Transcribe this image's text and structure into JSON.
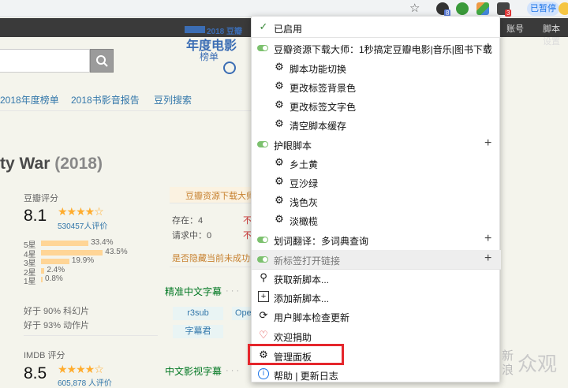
{
  "browser": {
    "paused_label": "已暂停",
    "ext_badge_1": "8",
    "ext_badge_2": "3"
  },
  "site_header": {
    "items": [
      "账号",
      "脚本设置"
    ]
  },
  "banner": {
    "line1": "2018 豆瓣",
    "line2": "年度电影",
    "line3": "榜单"
  },
  "nav": {
    "items": [
      "2018年度榜单",
      "2018书影音报告",
      "豆列搜索"
    ]
  },
  "movie": {
    "title": "ty War",
    "year": "(2018)"
  },
  "rating": {
    "label": "豆瓣评分",
    "score": "8.1",
    "stars": "★★★★☆",
    "count": "530457人评价",
    "breakdown": [
      {
        "star": "5星",
        "pct": "33.4%",
        "value": 33.4
      },
      {
        "star": "4星",
        "pct": "43.5%",
        "value": 43.5
      },
      {
        "star": "3星",
        "pct": "19.9%",
        "value": 19.9
      },
      {
        "star": "2星",
        "pct": "2.4%",
        "value": 2.4
      },
      {
        "star": "1星",
        "pct": "0.8%",
        "value": 0.8
      }
    ],
    "better1": "好于 90% 科幻片",
    "better2": "好于 93% 动作片",
    "imdb_label": "IMDB 评分",
    "imdb_score": "8.5",
    "imdb_count": "605,878 人评价"
  },
  "downloader": {
    "title": "豆瓣资源下载大师",
    "exist": "存在：4",
    "requesting": "请求中：0",
    "hide_note": "是否隐藏当前未成功的",
    "subtitle_title": "精准中文字幕",
    "tags": [
      "r3sub",
      "Ope",
      "字幕君"
    ],
    "film_subtitle": "中文影视字幕"
  },
  "menu": {
    "enabled": "已启用",
    "script1": "豆瓣资源下载大师：1秒搞定豆瓣电影|音乐|图书下载",
    "script1_items": [
      "脚本功能切换",
      "更改标签背景色",
      "更改标签文字色",
      "清空脚本缓存"
    ],
    "script2": "护眼脚本",
    "script2_items": [
      "乡土黄",
      "豆沙绿",
      "浅色灰",
      "淡橄榄"
    ],
    "script3": "划词翻译：多词典查询",
    "script4": "新标签打开链接",
    "get_new": "获取新脚本...",
    "add_new": "添加新脚本...",
    "check_update": "用户脚本检查更新",
    "donate": "欢迎捐助",
    "dashboard": "管理面板",
    "help": "帮助 | 更新日志"
  },
  "watermark": {
    "line1": "新",
    "line2": "浪",
    "text": "众观"
  },
  "colors": {
    "accent_link": "#3377aa",
    "toggle_green": "#7cc16e",
    "highlight_red": "#e5262c",
    "star_orange": "#ffac2d"
  }
}
